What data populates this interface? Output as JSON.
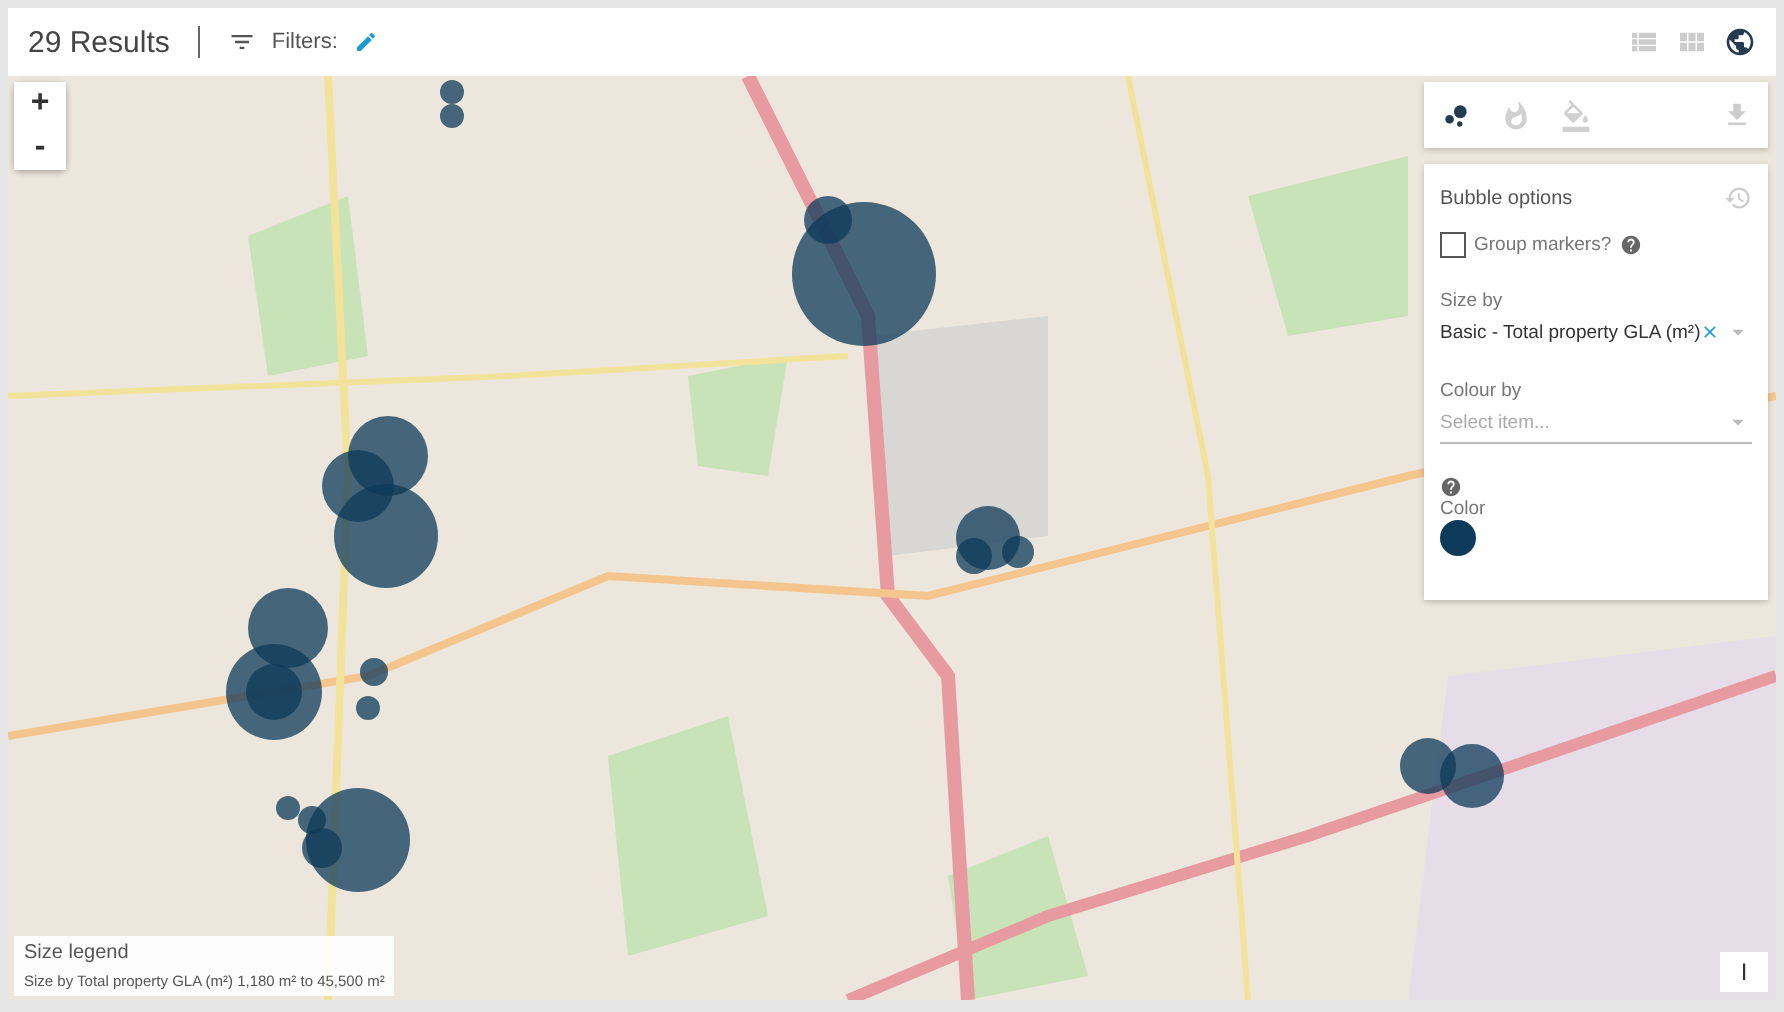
{
  "toolbar": {
    "result_count": "29 Results",
    "filters_label": "Filters:"
  },
  "map": {
    "kind": "picture",
    "zoom_buttons": [
      "+",
      "-"
    ]
  },
  "panel": {
    "tabs": [
      {
        "kind": "bubbles",
        "selected": true
      },
      {
        "kind": "heat",
        "selected": false
      },
      {
        "kind": "fill",
        "selected": false
      }
    ],
    "title": "Bubble options",
    "group_markers": {
      "label": "Group markers?",
      "checked": false
    },
    "size_by": {
      "label": "Size by",
      "value": "Basic - Total property GLA (m²)"
    },
    "colour_by": {
      "label": "Colour by",
      "placeholder": "Select item..."
    },
    "color_label": "Color",
    "color": "#0d3a5a"
  },
  "legend": {
    "title": "Size legend",
    "text": "Size by Total property GLA (m²) 1,180 m² to 45,500 m²"
  },
  "corner_button": "I"
}
